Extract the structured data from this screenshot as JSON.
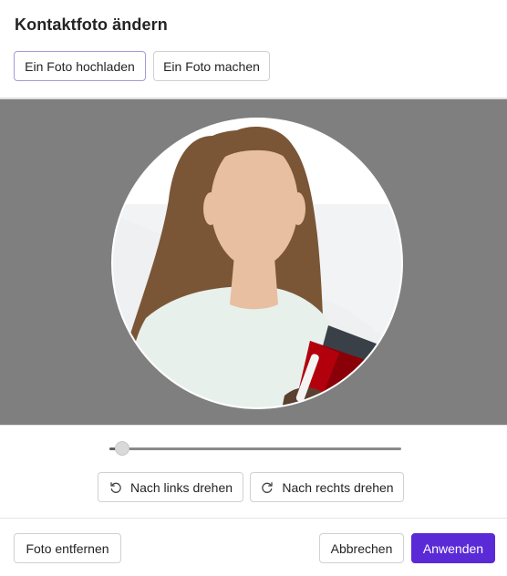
{
  "dialog": {
    "title": "Kontaktfoto ändern"
  },
  "source_tabs": {
    "upload_label": "Ein Foto hochladen",
    "capture_label": "Ein Foto machen",
    "selected": "upload"
  },
  "editor": {
    "zoom_level": 0.02,
    "rotate_left_label": "Nach links drehen",
    "rotate_right_label": "Nach rechts drehen"
  },
  "footer": {
    "remove_label": "Foto entfernen",
    "cancel_label": "Abbrechen",
    "apply_label": "Anwenden"
  },
  "colors": {
    "accent": "#5b2ad7",
    "overlay": "#7f7f7f"
  },
  "icons": {
    "rotate_left": "rotate-left-icon",
    "rotate_right": "rotate-right-icon"
  }
}
